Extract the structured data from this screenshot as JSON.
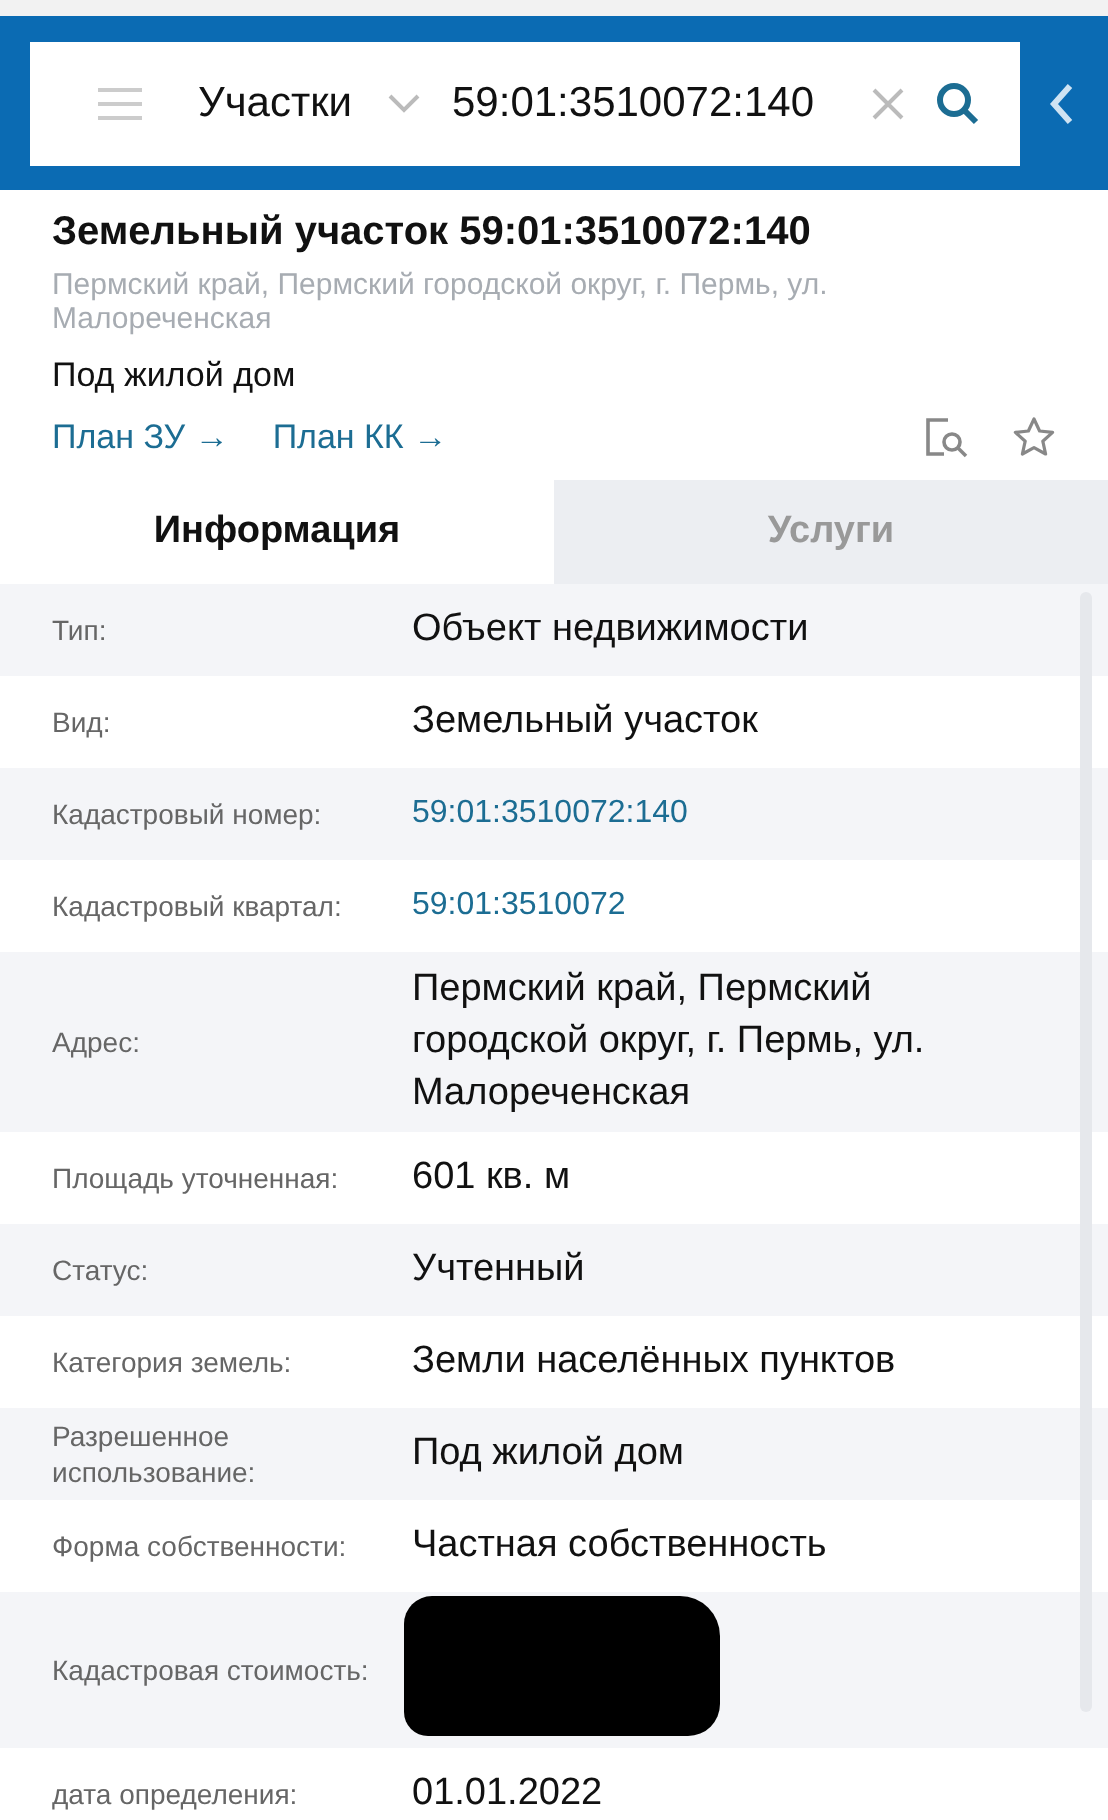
{
  "search_bar": {
    "category": "Участки",
    "query": "59:01:3510072:140"
  },
  "header": {
    "title": "Земельный участок 59:01:3510072:140",
    "address": "Пермский край, Пермский городской округ, г. Пермь, ул. Малореченская",
    "usage": "Под жилой дом",
    "links": [
      "План ЗУ",
      "План КК"
    ],
    "link_arrow": "→"
  },
  "tabs": [
    {
      "label": "Информация",
      "selected": true
    },
    {
      "label": "Услуги",
      "selected": false
    }
  ],
  "rows": [
    {
      "label": "Тип:",
      "value": "Объект недвижимости",
      "kind": "text"
    },
    {
      "label": "Вид:",
      "value": "Земельный участок",
      "kind": "text"
    },
    {
      "label": "Кадастровый номер:",
      "value": "59:01:3510072:140",
      "kind": "link"
    },
    {
      "label": "Кадастровый квартал:",
      "value": "59:01:3510072",
      "kind": "link"
    },
    {
      "label": "Адрес:",
      "value": "Пермский край, Пермский городской округ, г. Пермь, ул. Малореченская",
      "kind": "text"
    },
    {
      "label": "Площадь уточненная:",
      "value": "601 кв. м",
      "kind": "text"
    },
    {
      "label": "Статус:",
      "value": "Учтенный",
      "kind": "text"
    },
    {
      "label": "Категория земель:",
      "value": "Земли населённых пунктов",
      "kind": "text"
    },
    {
      "label": "Разрешенное использование:",
      "value": "Под жилой дом",
      "kind": "text"
    },
    {
      "label": "Форма собственности:",
      "value": "Частная собственность",
      "kind": "text"
    },
    {
      "label": "Кадастровая стоимость:",
      "kind": "redacted"
    },
    {
      "label": "дата определения:",
      "value": "01.01.2022",
      "kind": "text"
    }
  ]
}
